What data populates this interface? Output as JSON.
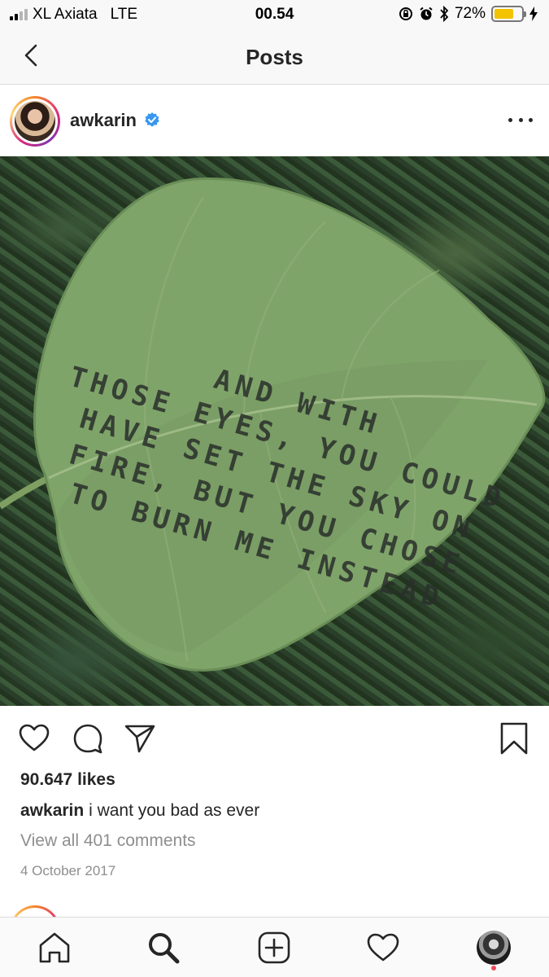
{
  "status_bar": {
    "carrier": "XL Axiata",
    "network": "LTE",
    "time": "00.54",
    "battery_percent": "72%",
    "battery_level": 0.72,
    "battery_color": "#f3c300"
  },
  "nav": {
    "title": "Posts",
    "back_icon": "chevron-left-icon"
  },
  "post": {
    "username": "awkarin",
    "verified": true,
    "verified_color": "#3897f0",
    "photo_text": [
      "And with",
      "those eyes, you could",
      "have set the sky on",
      "fire, but you chose",
      "to burn me instead"
    ],
    "likes": "90.647 likes",
    "caption_user": "awkarin",
    "caption_text": "i want you bad as ever",
    "view_comments": "View all 401 comments",
    "date": "4 October 2017"
  },
  "actions": {
    "icons": [
      "heart-icon",
      "comment-icon",
      "share-icon",
      "bookmark-icon"
    ]
  },
  "tabbar": {
    "tabs": [
      "home-icon",
      "search-icon",
      "add-icon",
      "activity-icon",
      "profile-avatar"
    ],
    "notification_color": "#ed4956"
  }
}
